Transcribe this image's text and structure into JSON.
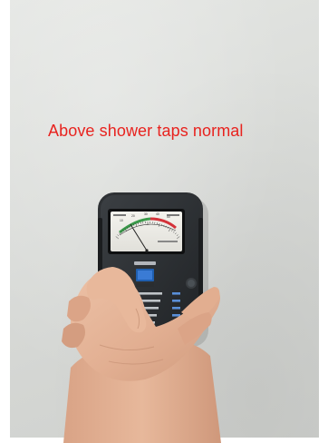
{
  "caption": "Above shower taps normal",
  "colors": {
    "caption": "#e8231f",
    "wall": "#dcdedb",
    "meter_body": "#2a2d30",
    "meter_bumper": "#3a3d40",
    "scale_green": "#3a9a4a",
    "scale_red": "#d4323a",
    "mode_blue": "#3a7bd5",
    "skin": "#e4b497"
  },
  "meter": {
    "device": "moisture-meter",
    "needle_level": 0.18,
    "scale_numbers": [
      "0",
      "10",
      "20",
      "30",
      "40",
      "50",
      "60"
    ],
    "mode_list_count": 5
  }
}
